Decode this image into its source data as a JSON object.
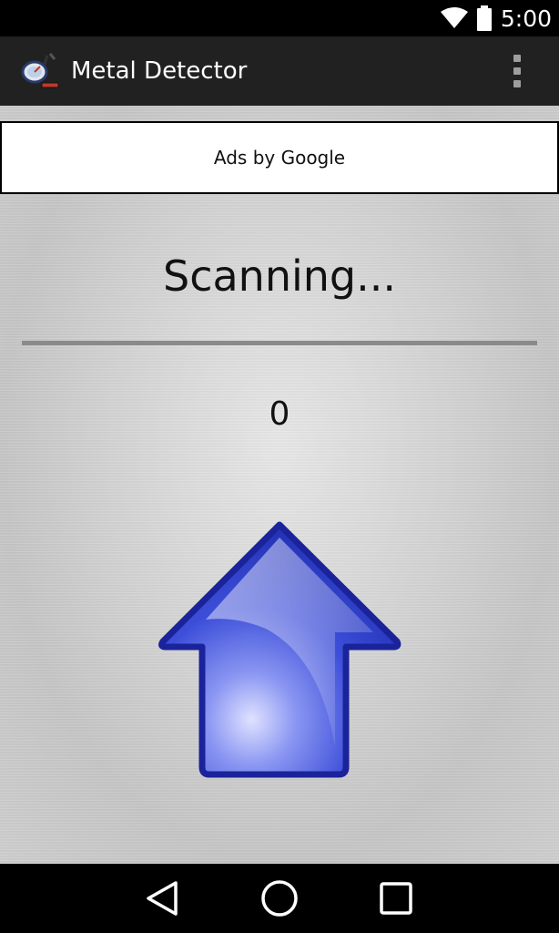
{
  "status_bar": {
    "time": "5:00",
    "icons": [
      "wifi-icon",
      "battery-icon"
    ]
  },
  "app_bar": {
    "title": "Metal Detector",
    "icon": "metal-detector-app-icon",
    "menu_icon": "overflow-menu-icon"
  },
  "ad": {
    "label": "Ads by Google"
  },
  "detector": {
    "status": "Scanning...",
    "reading": "0",
    "direction_icon": "up-arrow-icon"
  },
  "nav_bar": {
    "icons": [
      "back-icon",
      "home-icon",
      "recents-icon"
    ]
  },
  "colors": {
    "app_bar": "#212121",
    "arrow_blue": "#2b3fd1",
    "arrow_outline": "#1a2399",
    "divider": "#8a8a8a"
  }
}
